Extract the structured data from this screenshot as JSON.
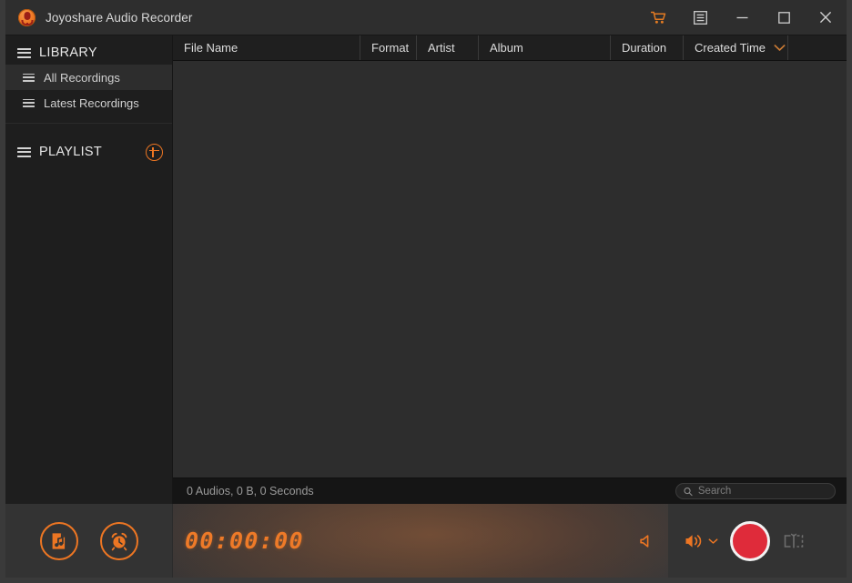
{
  "window": {
    "title": "Joyoshare Audio Recorder",
    "app_icon": "microphone-app-icon",
    "controls": {
      "cart": "shopping-cart-icon",
      "menu": "menu-list-icon",
      "minimize": "minimize-icon",
      "maximize": "maximize-icon",
      "close": "close-icon"
    },
    "accent_color": "#ed7623",
    "record_color": "#df2b3a",
    "background_color": "#2d2d2d"
  },
  "sidebar": {
    "library": {
      "title": "LIBRARY",
      "items": [
        {
          "label": "All Recordings",
          "selected": true
        },
        {
          "label": "Latest Recordings",
          "selected": false
        }
      ]
    },
    "playlist": {
      "title": "PLAYLIST",
      "add_icon": "plus-circle-icon",
      "items": []
    }
  },
  "table": {
    "columns": [
      {
        "key": "file_name",
        "label": "File Name"
      },
      {
        "key": "format",
        "label": "Format"
      },
      {
        "key": "artist",
        "label": "Artist"
      },
      {
        "key": "album",
        "label": "Album"
      },
      {
        "key": "duration",
        "label": "Duration"
      },
      {
        "key": "created_time",
        "label": "Created Time",
        "sorted": true,
        "sort_direction": "desc"
      }
    ],
    "rows": []
  },
  "status": {
    "summary": "0 Audios, 0 B, 0 Seconds",
    "search": {
      "placeholder": "Search",
      "value": "",
      "icon": "search-icon"
    }
  },
  "transport": {
    "left_buttons": [
      {
        "name": "audio-library-button",
        "icon": "music-file-icon"
      },
      {
        "name": "scheduler-button",
        "icon": "alarm-clock-icon"
      }
    ],
    "timer": "00:00:00",
    "mute_button": {
      "name": "mute-button",
      "icon": "speaker-mute-icon"
    },
    "volume_button": {
      "name": "volume-button",
      "icon": "speaker-waves-icon",
      "caret": "chevron-down-icon"
    },
    "record_button": {
      "name": "record-button",
      "icon": "record-circle-icon"
    },
    "trim_button": {
      "name": "trim-button",
      "icon": "trim-split-icon"
    }
  }
}
